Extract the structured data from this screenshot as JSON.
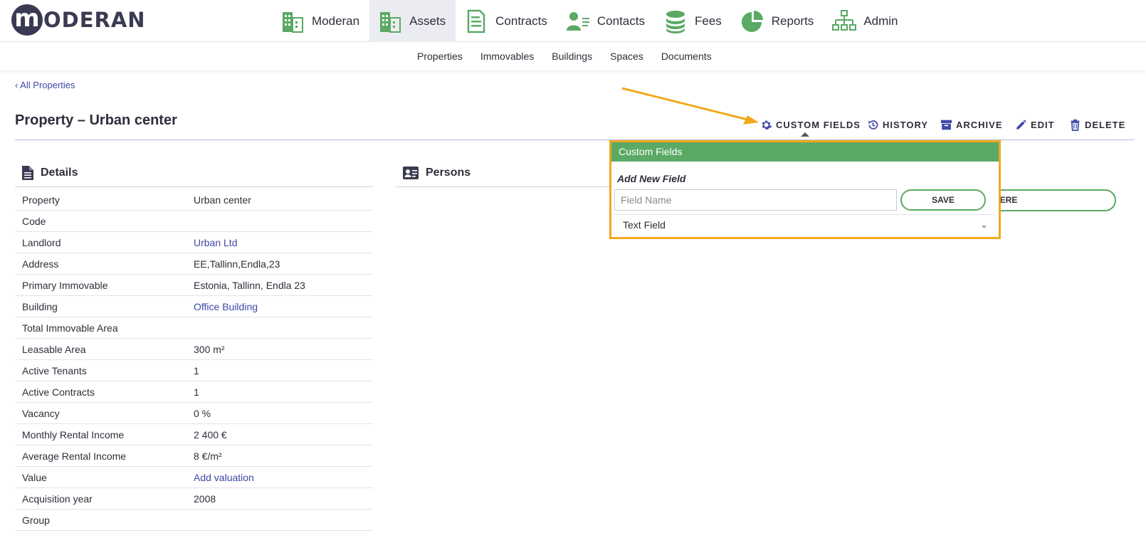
{
  "brand": {
    "logo_letter": "m",
    "logo_text": "ODERAN"
  },
  "main_nav": [
    {
      "label": "Moderan",
      "icon": "building-icon"
    },
    {
      "label": "Assets",
      "icon": "building-icon"
    },
    {
      "label": "Contracts",
      "icon": "document-icon"
    },
    {
      "label": "Contacts",
      "icon": "person-list-icon"
    },
    {
      "label": "Fees",
      "icon": "coins-icon"
    },
    {
      "label": "Reports",
      "icon": "pie-chart-icon"
    },
    {
      "label": "Admin",
      "icon": "sitemap-icon"
    }
  ],
  "sub_nav": [
    "Properties",
    "Immovables",
    "Buildings",
    "Spaces",
    "Documents"
  ],
  "breadcrumb": "‹ All Properties",
  "page_title": "Property – Urban center",
  "actions": {
    "custom_fields": "CUSTOM FIELDS",
    "history": "HISTORY",
    "archive": "ARCHIVE",
    "edit": "EDIT",
    "delete": "DELETE"
  },
  "details": {
    "heading": "Details",
    "rows": [
      {
        "label": "Property",
        "value": "Urban center"
      },
      {
        "label": "Code",
        "value": ""
      },
      {
        "label": "Landlord",
        "value": "Urban Ltd"
      },
      {
        "label": "Address",
        "value": "EE,Tallinn,Endla,23"
      },
      {
        "label": "Primary Immovable",
        "value": "Estonia, Tallinn, Endla 23"
      },
      {
        "label": "Building",
        "value": "Office Building"
      },
      {
        "label": "Total Immovable Area",
        "value": ""
      },
      {
        "label": "Leasable Area",
        "value": "300 m²"
      },
      {
        "label": "Active Tenants",
        "value": "1"
      },
      {
        "label": "Active Contracts",
        "value": "1"
      },
      {
        "label": "Vacancy",
        "value": "0 %"
      },
      {
        "label": "Monthly Rental Income",
        "value": "2 400 €"
      },
      {
        "label": "Average Rental Income",
        "value": "8 €/m²"
      },
      {
        "label": "Value",
        "value": "Add valuation"
      },
      {
        "label": "Acquisition year",
        "value": "2008"
      },
      {
        "label": "Group",
        "value": ""
      }
    ]
  },
  "persons": {
    "heading": "Persons",
    "button_partial": "HERE"
  },
  "custom_fields_popup": {
    "title": "Custom Fields",
    "subtitle": "Add New Field",
    "field_name_placeholder": "Field Name",
    "save_label": "SAVE",
    "type_selected": "Text Field"
  },
  "colors": {
    "accent_green": "#5aa964",
    "link_blue": "#3e48a8",
    "highlight_orange": "#f2a81d",
    "text_dark": "#2e2e3a"
  }
}
